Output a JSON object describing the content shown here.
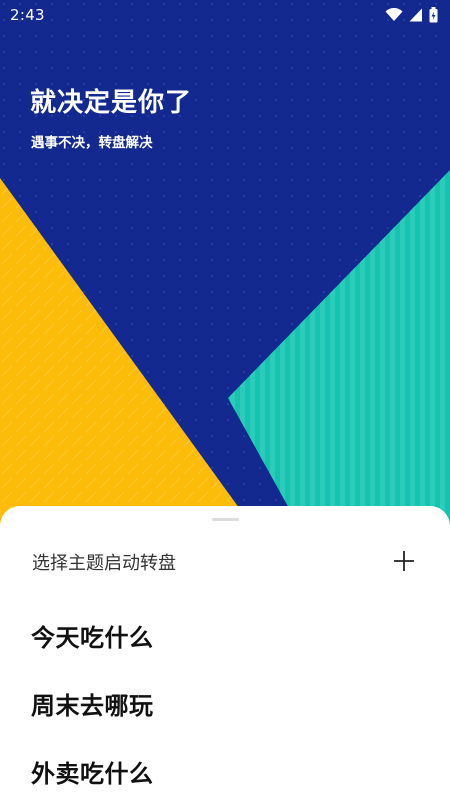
{
  "status_bar": {
    "time": "2:43",
    "icons": [
      "wifi-icon",
      "cellular-signal-icon",
      "battery-icon"
    ]
  },
  "hero": {
    "title": "就决定是你了",
    "subtitle": "遇事不决，转盘解决"
  },
  "colors": {
    "navy": "#13298f",
    "yellow": "#fdbb0a",
    "teal": "#16c3b0",
    "sheet": "#ffffff"
  },
  "sheet": {
    "header": "选择主题启动转盘",
    "add_icon": "plus-icon",
    "themes": [
      {
        "label": "今天吃什么"
      },
      {
        "label": "周末去哪玩"
      },
      {
        "label": "外卖吃什么"
      }
    ]
  }
}
